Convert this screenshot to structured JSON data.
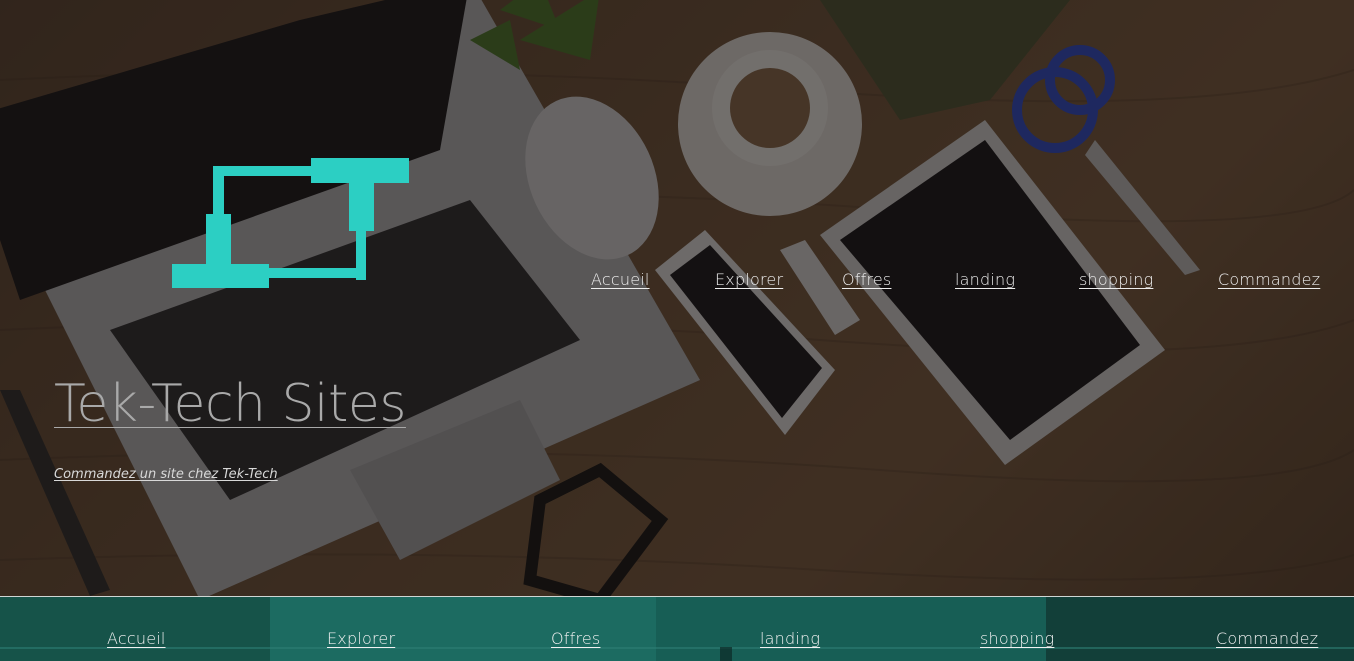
{
  "header": {
    "logo": {
      "icon": "laptop-logo-icon",
      "color": "#2ccfc3"
    },
    "nav": [
      {
        "label": "Accueil"
      },
      {
        "label": "Explorer"
      },
      {
        "label": "Offres"
      },
      {
        "label": "landing"
      },
      {
        "label": "shopping"
      },
      {
        "label": "Commandez"
      }
    ]
  },
  "hero": {
    "title": "Tek-Tech Sites",
    "tagline": "Commandez un site chez Tek-Tech",
    "background": "desk-photo-laptop-phone-tablet"
  },
  "footer_nav": {
    "background_color": "#175a52",
    "items": [
      {
        "label": "Accueil"
      },
      {
        "label": "Explorer"
      },
      {
        "label": "Offres"
      },
      {
        "label": "landing"
      },
      {
        "label": "shopping"
      },
      {
        "label": "Commandez"
      }
    ]
  }
}
